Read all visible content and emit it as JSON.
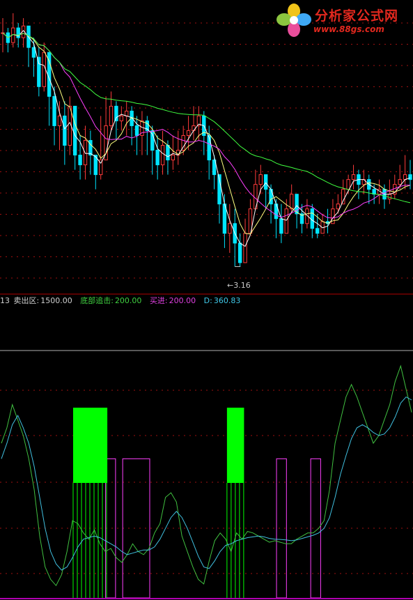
{
  "logo": {
    "title": "分析家公式网",
    "url": "www.88gs.com",
    "icon": "flower-icon",
    "colors": {
      "text": "#e2281e",
      "petals": [
        "#f0c419",
        "#3fa9f5",
        "#e94e9b",
        "#8cc63f"
      ]
    }
  },
  "indicator_bar": {
    "prefix": "13",
    "sell_zone_label": "卖出区:",
    "sell_zone_value": "1500.00",
    "bottom_chase_label": "底部追击:",
    "bottom_chase_value": "200.00",
    "buy_label": "买进:",
    "buy_value": "200.00",
    "d_label": "D:",
    "d_value": "360.83"
  },
  "colors": {
    "background": "#000000",
    "up_candle": "#ff3b3b",
    "down_candle": "#00e5ff",
    "ma_short": "#ffffff",
    "ma_mid": "#ffff80",
    "ma_long": "#ff40ff",
    "ma_longest": "#40ff40",
    "grid": "#a01010",
    "indicator_fast": "#40c040",
    "indicator_slow": "#40c0e0",
    "green_block": "#00ff00",
    "magenta_box": "#ff40ff",
    "separator": "#b00000"
  },
  "chart_data": [
    {
      "type": "candlestick",
      "title": "",
      "low_marker": "3.16",
      "grid": true,
      "count": 80,
      "ylim": [
        3.0,
        5.8
      ],
      "close": [
        5.55,
        5.45,
        5.6,
        5.5,
        5.62,
        5.4,
        5.3,
        5.0,
        5.35,
        4.9,
        4.6,
        4.7,
        4.4,
        4.8,
        4.3,
        4.2,
        4.45,
        4.3,
        4.1,
        4.25,
        4.6,
        4.8,
        4.65,
        4.7,
        4.75,
        4.6,
        4.5,
        4.65,
        4.55,
        4.35,
        4.2,
        4.4,
        4.25,
        4.3,
        4.35,
        4.5,
        4.55,
        4.6,
        4.7,
        4.5,
        4.25,
        4.1,
        3.8,
        3.5,
        3.6,
        3.4,
        3.2,
        3.5,
        3.75,
        4.0,
        4.1,
        3.95,
        3.8,
        3.65,
        3.5,
        3.75,
        3.9,
        3.7,
        3.6,
        3.75,
        3.55,
        3.5,
        3.62,
        3.6,
        3.75,
        3.8,
        3.95,
        4.05,
        4.1,
        4.0,
        4.05,
        3.95,
        3.9,
        3.95,
        3.85,
        3.9,
        4.0,
        4.05,
        4.1,
        4.05
      ],
      "high": [
        5.7,
        5.6,
        5.75,
        5.65,
        5.7,
        5.55,
        5.5,
        5.4,
        5.45,
        5.2,
        5.0,
        4.85,
        4.85,
        4.9,
        4.75,
        4.5,
        4.6,
        4.55,
        4.3,
        4.7,
        4.9,
        4.95,
        4.85,
        4.8,
        4.85,
        4.8,
        4.7,
        4.75,
        4.7,
        4.6,
        4.5,
        4.55,
        4.45,
        4.5,
        4.55,
        4.6,
        4.7,
        4.8,
        4.8,
        4.75,
        4.6,
        4.3,
        4.05,
        3.9,
        3.8,
        3.75,
        3.5,
        3.65,
        3.85,
        4.15,
        4.2,
        4.1,
        4.0,
        3.85,
        3.8,
        3.85,
        4.0,
        3.9,
        3.8,
        3.85,
        3.8,
        3.7,
        3.7,
        3.75,
        3.85,
        3.9,
        4.05,
        4.1,
        4.2,
        4.15,
        4.15,
        4.1,
        4.0,
        4.05,
        4.0,
        4.05,
        4.1,
        4.2,
        4.3,
        4.25
      ],
      "low": [
        5.35,
        5.35,
        5.4,
        5.4,
        5.4,
        5.2,
        5.1,
        4.9,
        4.95,
        4.6,
        4.4,
        4.35,
        4.2,
        4.3,
        4.15,
        4.05,
        4.05,
        4.1,
        3.95,
        4.05,
        4.3,
        4.55,
        4.45,
        4.55,
        4.5,
        4.4,
        4.3,
        4.3,
        4.3,
        4.1,
        4.05,
        4.1,
        4.1,
        4.15,
        4.2,
        4.3,
        4.35,
        4.45,
        4.45,
        4.3,
        4.05,
        3.95,
        3.6,
        3.35,
        3.3,
        3.16,
        3.16,
        3.35,
        3.5,
        3.8,
        3.9,
        3.75,
        3.6,
        3.45,
        3.4,
        3.55,
        3.7,
        3.55,
        3.5,
        3.55,
        3.45,
        3.45,
        3.5,
        3.5,
        3.6,
        3.7,
        3.8,
        3.9,
        3.95,
        3.85,
        3.9,
        3.8,
        3.8,
        3.8,
        3.75,
        3.8,
        3.85,
        3.95,
        3.95,
        3.95
      ],
      "moving_averages": [
        {
          "name": "MA5",
          "color": "#ffffff"
        },
        {
          "name": "MA10",
          "color": "#ffff80"
        },
        {
          "name": "MA20",
          "color": "#ff40ff"
        },
        {
          "name": "MA60",
          "color": "#40ff40"
        }
      ]
    },
    {
      "type": "line",
      "title": "",
      "grid": true,
      "ylim": [
        0,
        1600
      ],
      "levels": {
        "sell_zone": 1500,
        "bottom_chase": 200,
        "buy": 200
      },
      "series": [
        {
          "key": "fast",
          "color": "#40c040",
          "values": [
            1000,
            1100,
            1250,
            1150,
            1050,
            900,
            700,
            400,
            200,
            120,
            80,
            150,
            300,
            500,
            480,
            420,
            380,
            440,
            350,
            300,
            320,
            260,
            230,
            280,
            350,
            300,
            280,
            320,
            420,
            480,
            650,
            680,
            620,
            400,
            300,
            200,
            120,
            90,
            240,
            370,
            420,
            380,
            300,
            420,
            380,
            430,
            420,
            400,
            380,
            360,
            370,
            360,
            350,
            350,
            380,
            400,
            420,
            420,
            450,
            500,
            700,
            1000,
            1150,
            1300,
            1380,
            1300,
            1200,
            1100,
            1000,
            1050,
            1150,
            1250,
            1400,
            1500,
            1350,
            1200
          ]
        },
        {
          "key": "slow",
          "color": "#40c0e0",
          "values": [
            900,
            1000,
            1120,
            1180,
            1100,
            1000,
            850,
            650,
            450,
            300,
            220,
            180,
            200,
            260,
            330,
            380,
            390,
            400,
            390,
            370,
            350,
            330,
            300,
            280,
            290,
            300,
            310,
            310,
            330,
            380,
            450,
            520,
            560,
            520,
            450,
            360,
            270,
            200,
            190,
            240,
            300,
            340,
            350,
            370,
            380,
            390,
            395,
            400,
            395,
            385,
            380,
            378,
            375,
            370,
            375,
            385,
            395,
            405,
            420,
            450,
            520,
            650,
            800,
            920,
            1030,
            1100,
            1120,
            1100,
            1070,
            1050,
            1060,
            1100,
            1170,
            1260,
            1300,
            1280
          ]
        }
      ],
      "green_blocks": [
        [
          4,
          5
        ],
        [
          13,
          13
        ]
      ],
      "magenta_boxes": [
        [
          3,
          3
        ],
        [
          4,
          5
        ],
        [
          13,
          13
        ],
        [
          15,
          15
        ]
      ]
    }
  ]
}
